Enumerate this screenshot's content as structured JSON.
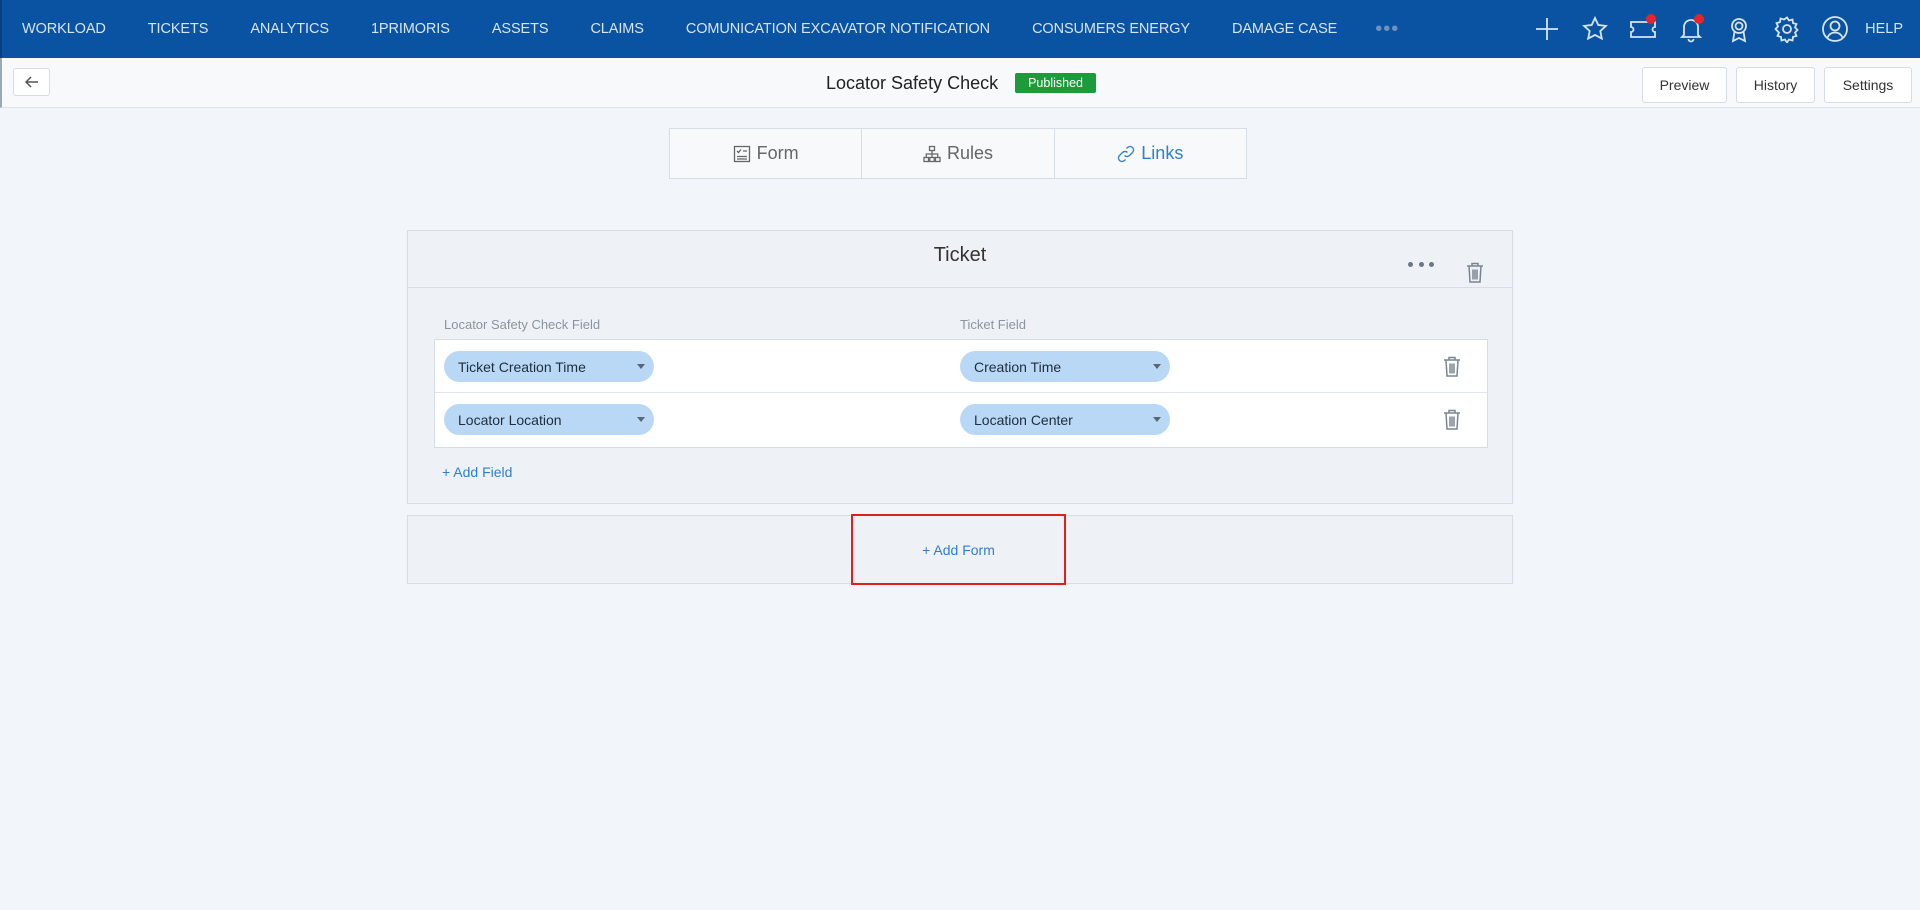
{
  "nav": {
    "items": [
      "WORKLOAD",
      "TICKETS",
      "ANALYTICS",
      "1PRIMORIS",
      "ASSETS",
      "CLAIMS",
      "COMUNICATION EXCAVATOR NOTIFICATION",
      "CONSUMERS ENERGY",
      "DAMAGE CASE"
    ],
    "more": "•••",
    "help": "HELP",
    "icons": [
      "plus-icon",
      "star-icon",
      "ticket-icon",
      "bell-icon",
      "award-icon",
      "gear-icon",
      "user-icon"
    ],
    "notification_color": "#e5242b",
    "background": "#0a53a2"
  },
  "header": {
    "title": "Locator Safety Check",
    "status": "Published",
    "status_color": "#1d9a3a",
    "preview": "Preview",
    "history": "History",
    "settings": "Settings"
  },
  "tabs": [
    {
      "label": "Form",
      "icon": "form-icon",
      "active": false
    },
    {
      "label": "Rules",
      "icon": "rules-icon",
      "active": false
    },
    {
      "label": "Links",
      "icon": "link-icon",
      "active": true
    }
  ],
  "link_card": {
    "title": "Ticket",
    "left_column": "Locator Safety Check Field",
    "right_column": "Ticket Field",
    "rows": [
      {
        "source": "Ticket Creation Time",
        "target": "Creation Time"
      },
      {
        "source": "Locator Location",
        "target": "Location Center"
      }
    ],
    "add_field": "+ Add Field"
  },
  "add_form": "+ Add Form",
  "accent_color": "#2f7fd1"
}
